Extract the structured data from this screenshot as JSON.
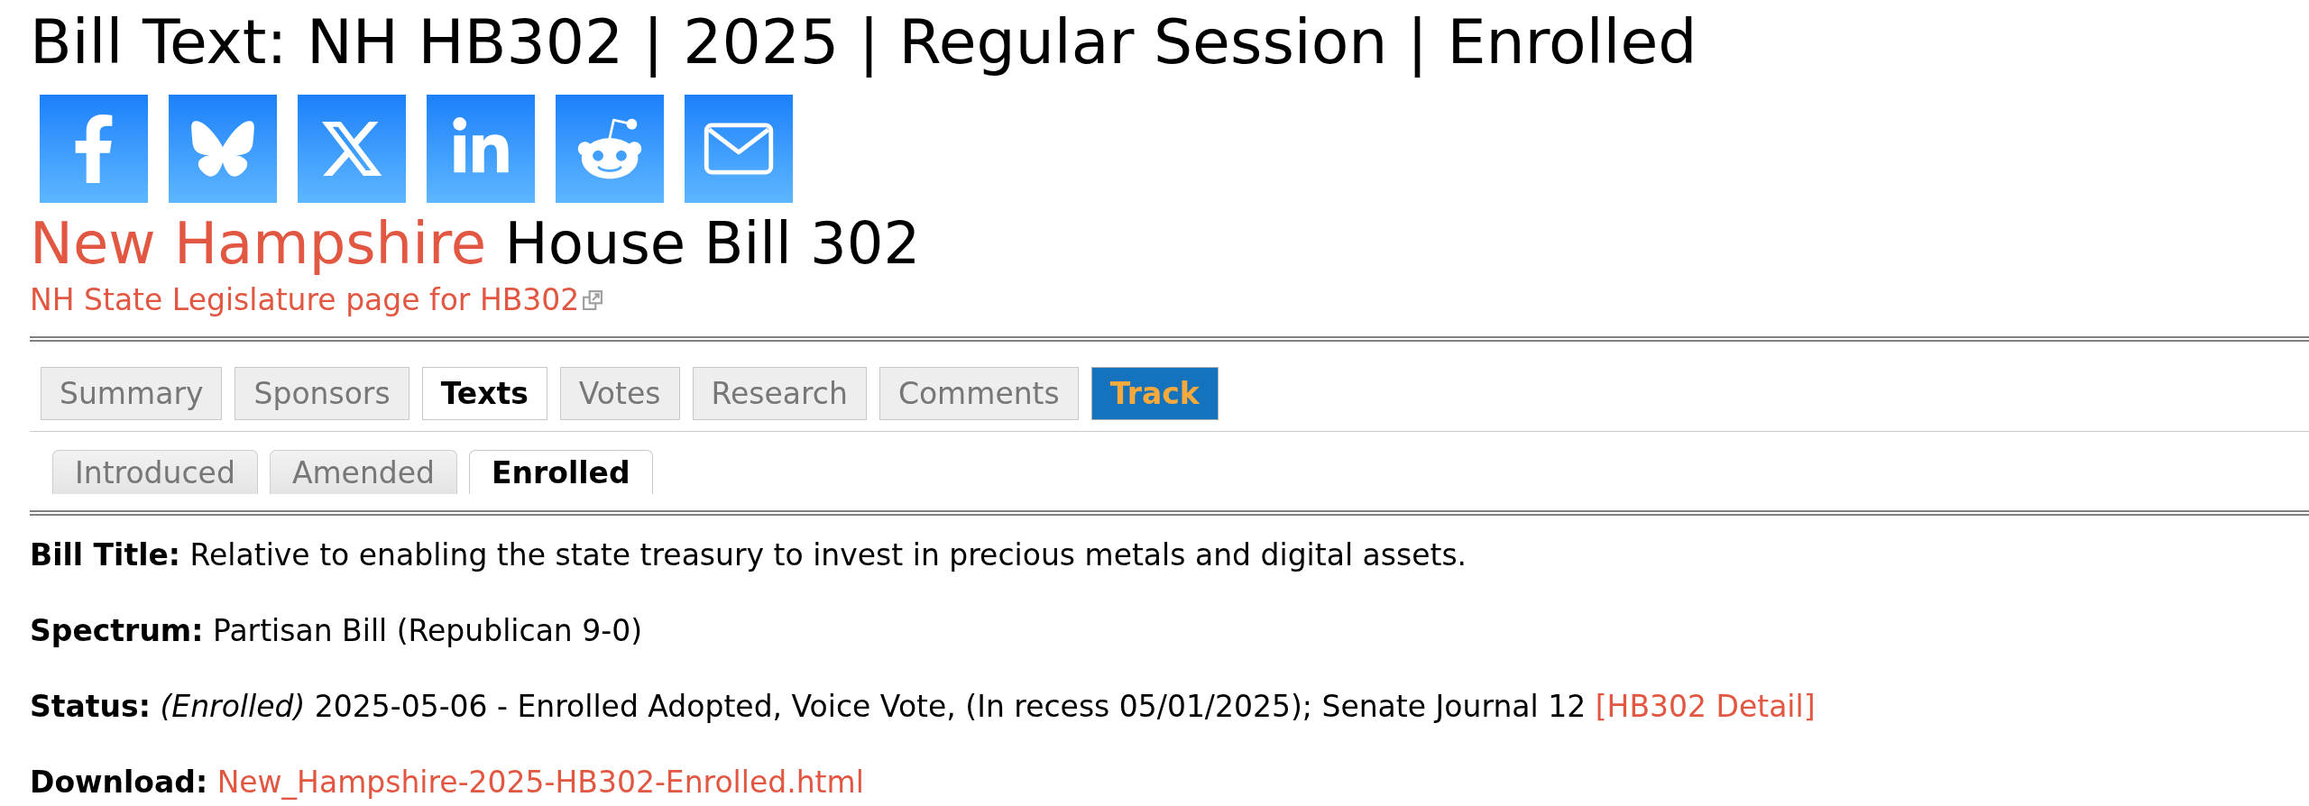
{
  "page_title": "Bill Text: NH HB302 | 2025 | Regular Session | Enrolled",
  "heading": {
    "state": "New Hampshire",
    "title": "House Bill 302"
  },
  "state_link": "NH State Legislature page for HB302",
  "tabs": [
    {
      "label": "Summary",
      "selected": false
    },
    {
      "label": "Sponsors",
      "selected": false
    },
    {
      "label": "Texts",
      "selected": true
    },
    {
      "label": "Votes",
      "selected": false
    },
    {
      "label": "Research",
      "selected": false
    },
    {
      "label": "Comments",
      "selected": false
    }
  ],
  "track_button": "Track",
  "text_tabs": [
    {
      "label": "Introduced",
      "selected": false
    },
    {
      "label": "Amended",
      "selected": false
    },
    {
      "label": "Enrolled",
      "selected": true
    }
  ],
  "details": [
    {
      "label": "Bill Title:",
      "value": "Relative to enabling the state treasury to invest in precious metals and digital assets."
    },
    {
      "label": "Spectrum:",
      "value": "Partisan Bill (Republican 9-0)"
    },
    {
      "label": "Status:",
      "value": "*(Enrolled)* 2025-05-06 - Enrolled Adopted, Voice Vote, (In recess 05/01/2025); Senate Journal 12",
      "link": "[HB302 Detail]"
    },
    {
      "label": "Download:",
      "link": "New_Hampshire-2025-HB302-Enrolled.html"
    }
  ]
}
